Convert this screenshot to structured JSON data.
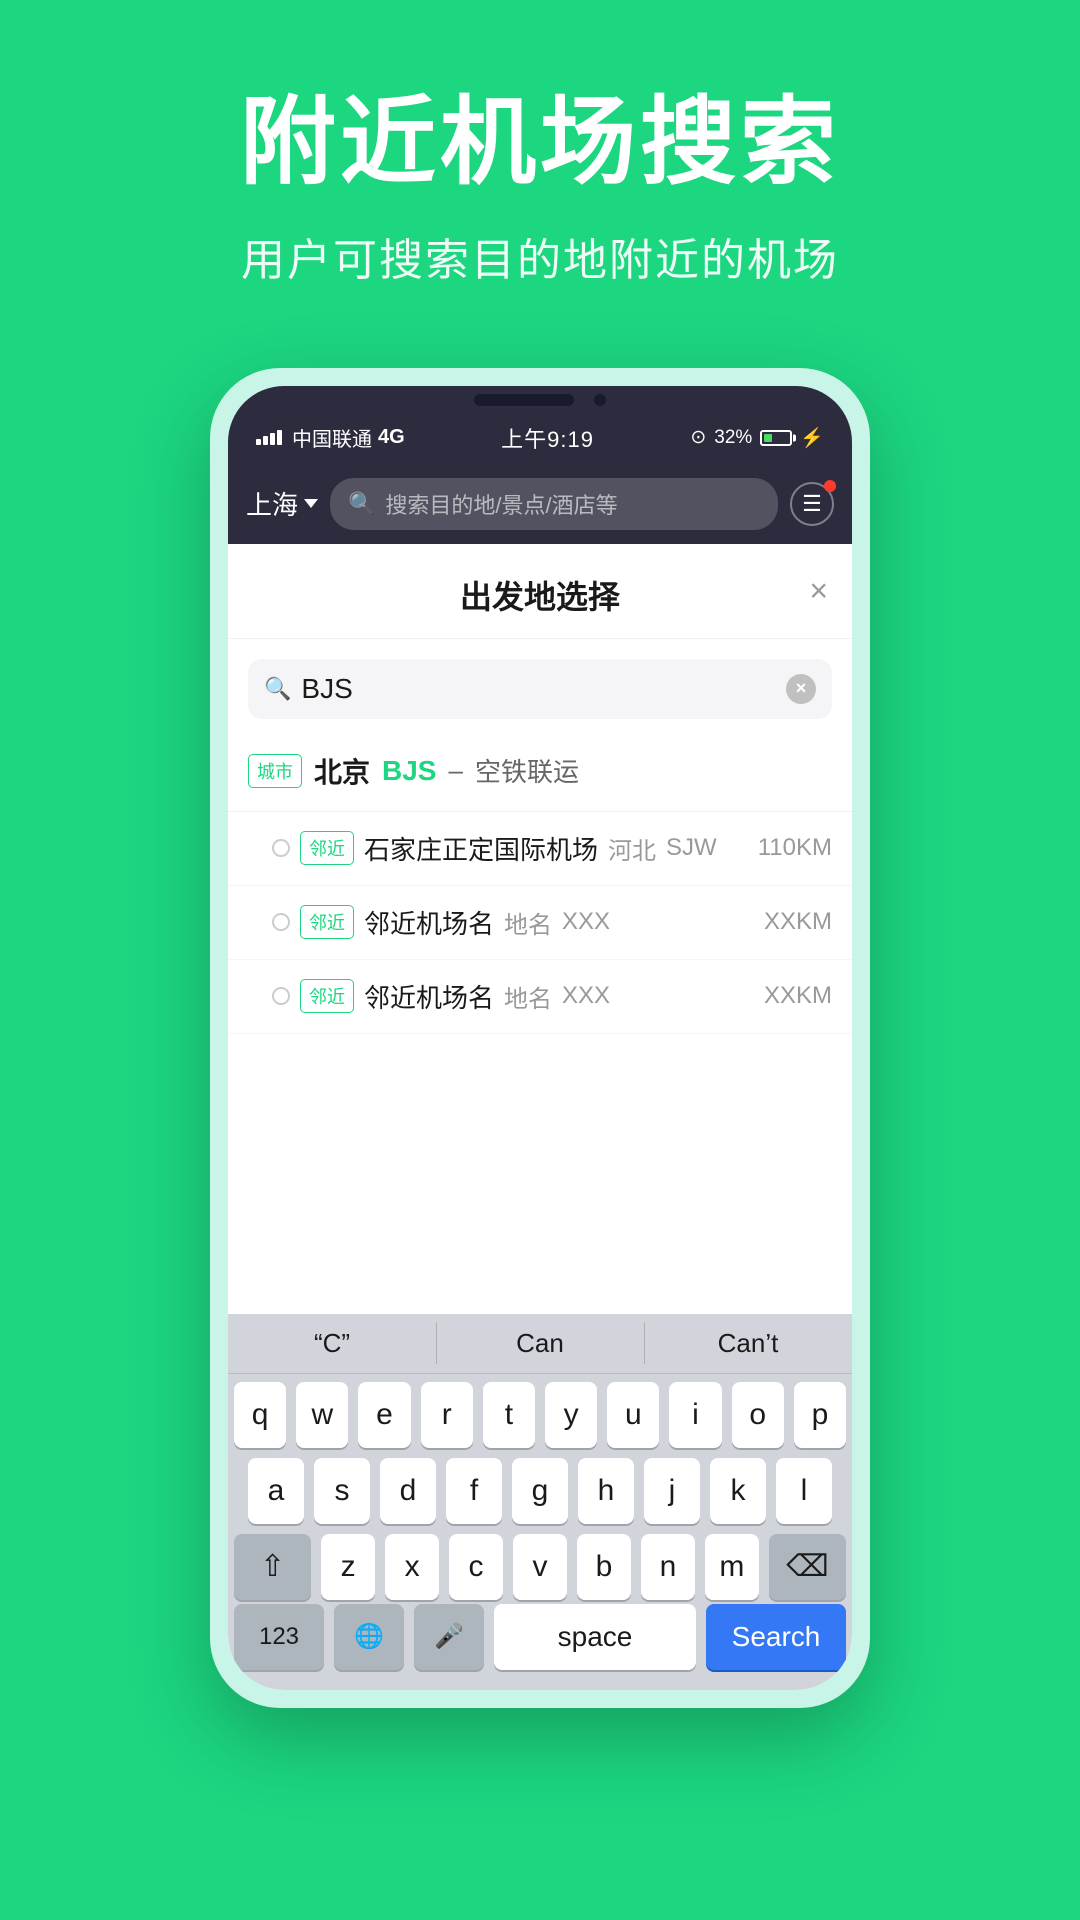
{
  "hero": {
    "title": "附近机场搜索",
    "subtitle": "用户可搜索目的地附近的机场"
  },
  "status_bar": {
    "carrier": "中国联通",
    "network": "4G",
    "time": "上午9:19",
    "battery_percent": "32%"
  },
  "app_header": {
    "city": "上海",
    "search_placeholder": "搜索目的地/景点/酒店等"
  },
  "modal": {
    "title": "出发地选择",
    "close_label": "×",
    "search_value": "BJS",
    "city_result": {
      "tag": "城市",
      "name": "北京",
      "code": "BJS",
      "dash": "–",
      "service": "空铁联运"
    },
    "nearby_airports": [
      {
        "tag": "邻近",
        "name": "石家庄正定国际机场",
        "region": "河北",
        "code": "SJW",
        "distance": "110KM"
      },
      {
        "tag": "邻近",
        "name": "邻近机场名",
        "region": "地名",
        "code": "XXX",
        "distance": "XXKM"
      },
      {
        "tag": "邻近",
        "name": "邻近机场名",
        "region": "地名",
        "code": "XXX",
        "distance": "XXKM"
      }
    ]
  },
  "keyboard": {
    "suggestions": [
      {
        "label": "“C”"
      },
      {
        "label": "Can"
      },
      {
        "label": "Can’t"
      }
    ],
    "rows": [
      [
        "q",
        "w",
        "e",
        "r",
        "t",
        "y",
        "u",
        "i",
        "o",
        "p"
      ],
      [
        "a",
        "s",
        "d",
        "f",
        "g",
        "h",
        "j",
        "k",
        "l"
      ],
      [
        "z",
        "x",
        "c",
        "v",
        "b",
        "n",
        "m"
      ]
    ],
    "bottom": {
      "num_label": "123",
      "space_label": "space",
      "search_label": "Search"
    }
  }
}
